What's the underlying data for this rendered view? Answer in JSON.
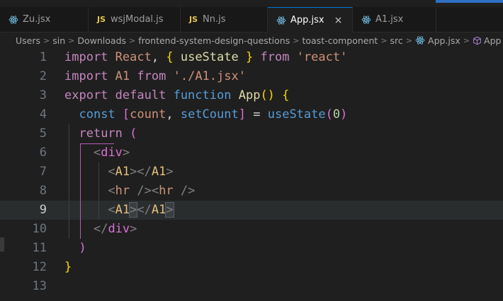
{
  "tabs": [
    {
      "label": "Zu.jsx",
      "icon": "react-icon"
    },
    {
      "label": "wsjModal.js",
      "icon": "js-icon"
    },
    {
      "label": "Nn.js",
      "icon": "js-icon"
    },
    {
      "label": "App.jsx",
      "icon": "react-icon",
      "active": true
    },
    {
      "label": "A1.jsx",
      "icon": "react-icon"
    }
  ],
  "js_badge": "JS",
  "close_glyph": "×",
  "breadcrumb": [
    "Users",
    "sin",
    "Downloads",
    "frontend-system-design-questions",
    "toast-component",
    "src",
    "App.jsx",
    "App"
  ],
  "line_numbers": [
    "1",
    "2",
    "3",
    "4",
    "5",
    "6",
    "7",
    "8",
    "9",
    "10",
    "11",
    "12",
    "13"
  ],
  "current_line": "9",
  "code": {
    "l1": {
      "t1": "import",
      "t2": "React",
      "t3": "useState",
      "t4": "from",
      "t5": "'react'"
    },
    "l2": {
      "t1": "import",
      "t2": "A1",
      "t3": "from",
      "t4": "'./A1.jsx'"
    },
    "l3": {
      "t1": "export",
      "t2": "default",
      "t3": "function",
      "t4": "App"
    },
    "l4": {
      "t1": "const",
      "t2": "count",
      "t3": "setCount",
      "t4": "useState",
      "t5": "0"
    },
    "l5": {
      "t1": "return"
    },
    "l6": {
      "t1": "div"
    },
    "l7": {
      "t1": "A1",
      "t2": "A1"
    },
    "l8": {
      "t1": "hr",
      "t2": "hr"
    },
    "l9": {
      "t1": "A1",
      "t2": "A1"
    },
    "l10": {
      "t1": "div"
    }
  },
  "colors": {
    "accent": "#0078d4",
    "background": "#1f1f1f"
  }
}
